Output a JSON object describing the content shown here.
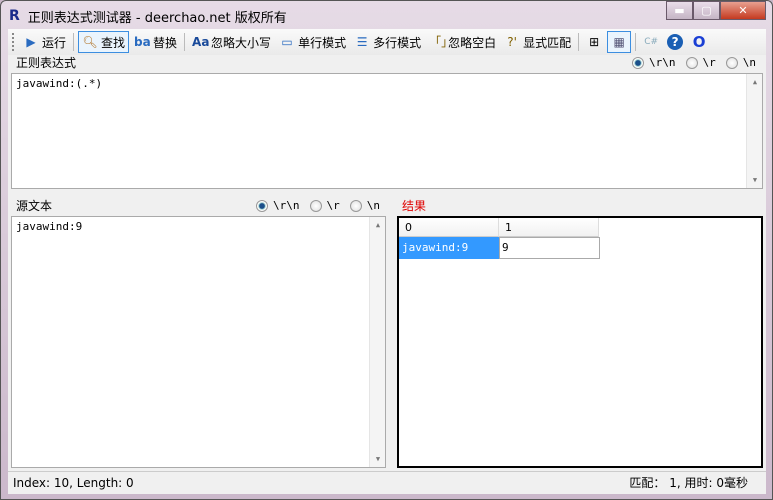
{
  "window": {
    "title": "正则表达式测试器 - deerchao.net 版权所有",
    "logo": "R"
  },
  "toolbar": {
    "run": "运行",
    "find": "查找",
    "replace": "替换",
    "ignore_case": "忽略大小写",
    "single_line": "单行模式",
    "multi_line": "多行模式",
    "ignore_whitespace": "忽略空白",
    "explicit_capture": "显式匹配"
  },
  "regex": {
    "label": "正则表达式",
    "value": "javawind:(.*)",
    "newline_options": [
      "\\r\\n",
      "\\r",
      "\\n"
    ],
    "selected": "\\r\\n"
  },
  "source": {
    "label": "源文本",
    "value": "javawind:9",
    "newline_options": [
      "\\r\\n",
      "\\r",
      "\\n"
    ],
    "selected": "\\r\\n"
  },
  "results": {
    "label": "结果",
    "columns": [
      "0",
      "1"
    ],
    "rows": [
      [
        "javawind:9",
        "9"
      ]
    ]
  },
  "status": {
    "left": "Index: 10, Length: 0",
    "right": "匹配： 1, 用时: 0毫秒"
  }
}
